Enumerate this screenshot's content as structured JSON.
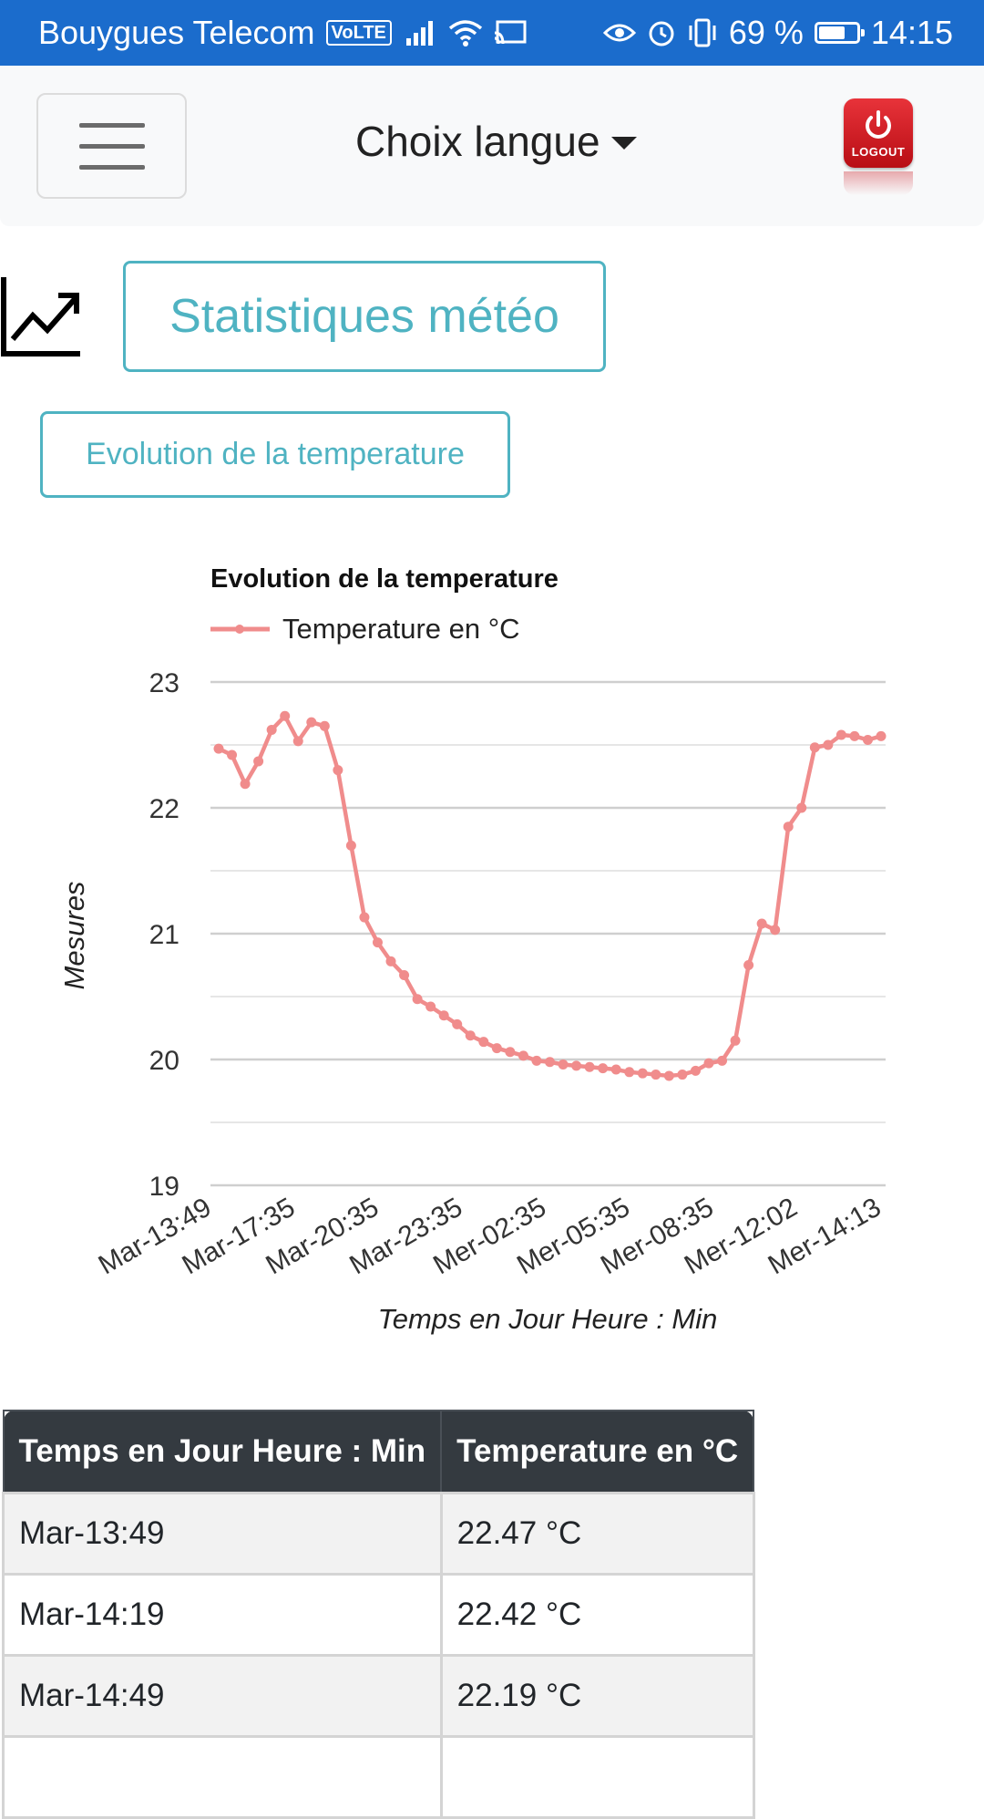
{
  "status_bar": {
    "carrier": "Bouygues Telecom",
    "volte": "VoLTE",
    "battery": "69 %",
    "battery_level": 0.69,
    "time": "14:15",
    "color": "#1b6ccc"
  },
  "navbar": {
    "menu_icon": "hamburger-icon",
    "language_label": "Choix langue",
    "logout_label": "LOGOUT",
    "logout_icon": "power-icon"
  },
  "header": {
    "icon": "line-chart-icon",
    "title": "Statistiques météo",
    "sub_button": "Evolution de la temperature",
    "accent": "#4fb3c2"
  },
  "chart_data": {
    "type": "line",
    "title": "Evolution de la temperature",
    "xlabel": "Temps en Jour Heure : Min",
    "ylabel": "Mesures",
    "ylim": [
      19,
      23
    ],
    "yticks": [
      19,
      20,
      21,
      22,
      23
    ],
    "grid": true,
    "legend_position": "top-left",
    "xticks": [
      "Mar-13:49",
      "Mar-17:35",
      "Mar-20:35",
      "Mar-23:35",
      "Mer-02:35",
      "Mer-05:35",
      "Mer-08:35",
      "Mer-12:02",
      "Mer-14:13"
    ],
    "series": [
      {
        "name": "Temperature en °C",
        "color": "#f08c8c",
        "values": [
          22.47,
          22.42,
          22.19,
          22.37,
          22.62,
          22.73,
          22.53,
          22.68,
          22.65,
          22.3,
          21.7,
          21.13,
          20.93,
          20.78,
          20.67,
          20.48,
          20.42,
          20.35,
          20.28,
          20.19,
          20.14,
          20.09,
          20.06,
          20.03,
          19.99,
          19.98,
          19.96,
          19.95,
          19.94,
          19.93,
          19.92,
          19.9,
          19.89,
          19.88,
          19.87,
          19.88,
          19.91,
          19.97,
          19.99,
          20.15,
          20.75,
          21.08,
          21.03,
          21.85,
          22.0,
          22.48,
          22.5,
          22.58,
          22.57,
          22.54,
          22.57
        ]
      }
    ]
  },
  "table": {
    "headers": [
      "Temps en Jour Heure : Min",
      "Temperature en °C"
    ],
    "rows": [
      [
        "Mar-13:49",
        "22.47 °C"
      ],
      [
        "Mar-14:19",
        "22.42 °C"
      ],
      [
        "Mar-14:49",
        "22.19 °C"
      ]
    ]
  }
}
